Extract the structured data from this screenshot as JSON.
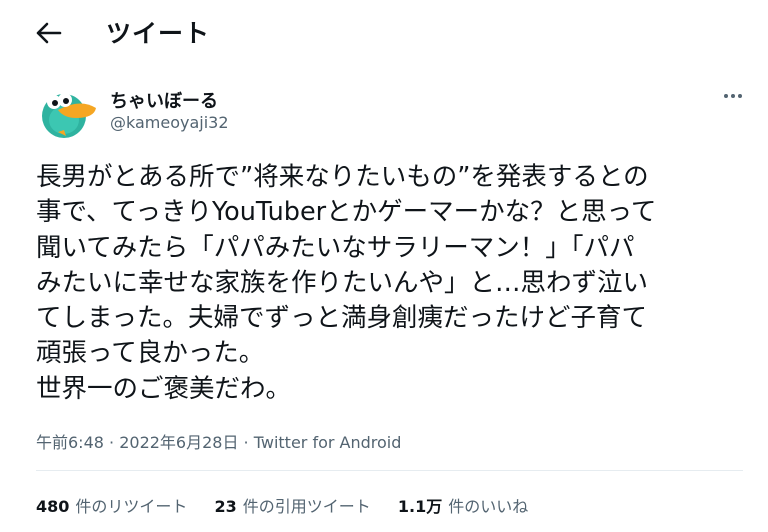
{
  "header": {
    "title": "ツイート"
  },
  "author": {
    "display_name": "ちゃいぼーる",
    "handle": "@kameoyaji32"
  },
  "tweet": {
    "lines": [
      "長男がとある所で”将来なりたいもの”を発表するとの",
      "事で、てっきりYouTuberとかゲーマーかな？と思って",
      "聞いてみたら「パパみたいなサラリーマン！」「パパ",
      "みたいに幸せな家族を作りたいんや」と…思わず泣い",
      "てしまった。夫婦でずっと満身創痍だったけど子育て",
      "頑張って良かった。",
      "世界一のご褒美だわ。"
    ]
  },
  "meta": {
    "time": "午前6:48",
    "separator": " · ",
    "date": "2022年6月28日",
    "source": "Twitter for Android"
  },
  "stats": {
    "retweets": {
      "count": "480",
      "label": "件のリツイート"
    },
    "quotes": {
      "count": "23",
      "label": "件の引用ツイート"
    },
    "likes": {
      "count": "1.1万",
      "label": "件のいいね"
    }
  },
  "icons": {
    "back": "arrow-left-icon",
    "more": "more-dots-icon",
    "avatar": "platypus-avatar"
  },
  "colors": {
    "text": "#0f1419",
    "secondary": "#536471",
    "divider": "#e6ecf0",
    "avatar_body": "#2fb3a0",
    "avatar_bill": "#f5a623"
  }
}
